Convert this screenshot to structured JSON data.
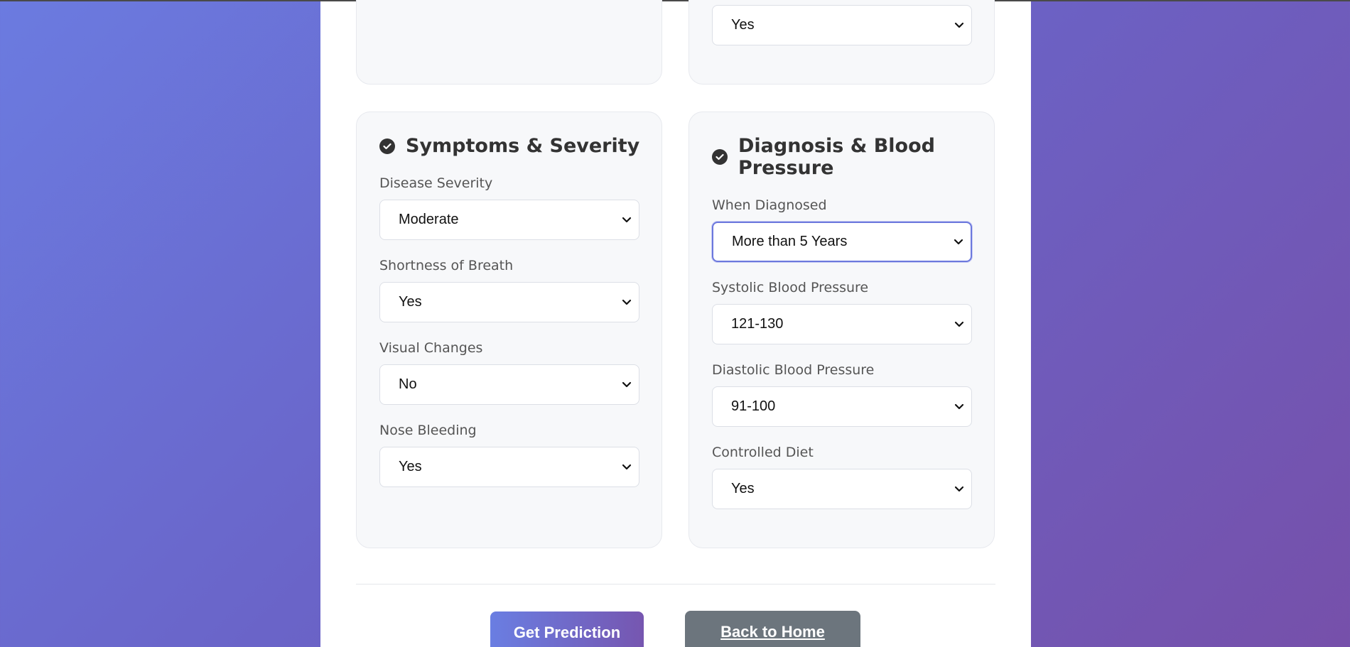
{
  "top_card": {
    "select_value": "Yes"
  },
  "symptoms": {
    "title": "Symptoms & Severity",
    "fields": [
      {
        "label": "Disease Severity",
        "value": "Moderate"
      },
      {
        "label": "Shortness of Breath",
        "value": "Yes"
      },
      {
        "label": "Visual Changes",
        "value": "No"
      },
      {
        "label": "Nose Bleeding",
        "value": "Yes"
      }
    ]
  },
  "diagnosis": {
    "title_line1": "Diagnosis & Blood",
    "title_line2": "Pressure",
    "fields": [
      {
        "label": "When Diagnosed",
        "value": "More than 5 Years"
      },
      {
        "label": "Systolic Blood Pressure",
        "value": "121-130"
      },
      {
        "label": "Diastolic Blood Pressure",
        "value": "91-100"
      },
      {
        "label": "Controlled Diet",
        "value": "Yes"
      }
    ]
  },
  "actions": {
    "predict_label": "Get Prediction",
    "home_label": "Back to Home"
  },
  "icons": {
    "section_check": "check-circle-icon",
    "dropdown": "chevron-down-icon"
  },
  "colors": {
    "focus_border": "#6c78dd",
    "secondary_button": "#6c757d"
  }
}
